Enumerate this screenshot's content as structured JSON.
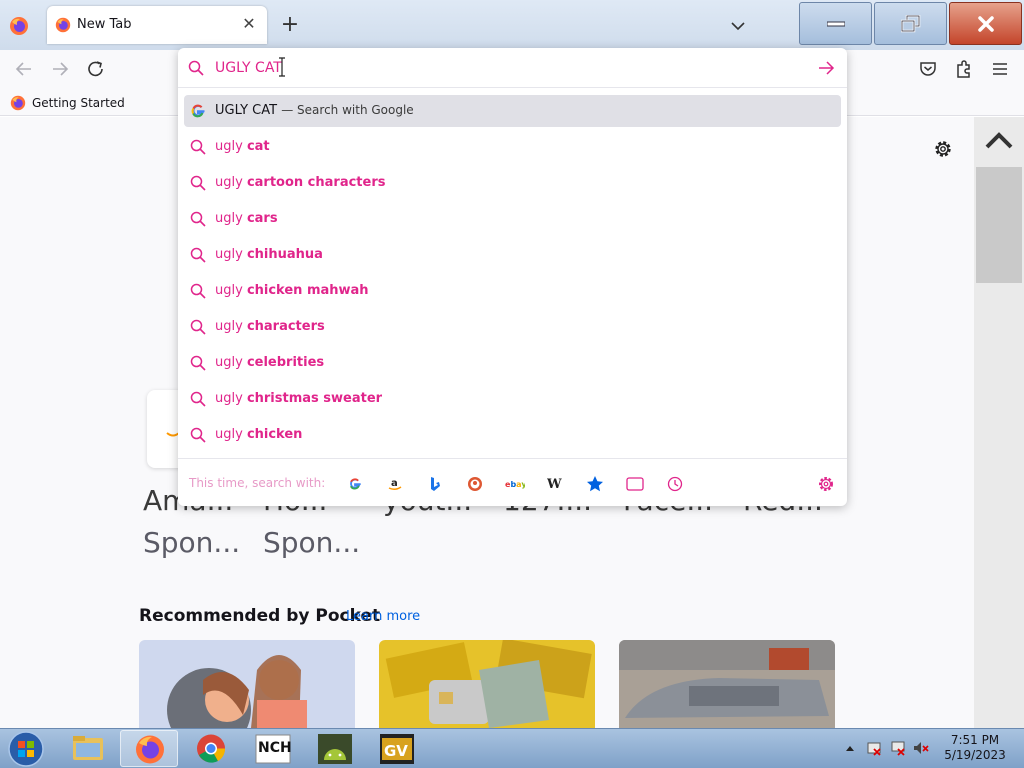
{
  "window": {
    "tab_title": "New Tab",
    "new_tab": "+",
    "close_tab": "✕"
  },
  "bookmarks": {
    "item_label": "Getting Started"
  },
  "urlbar": {
    "value": "UGLY CAT",
    "selected": {
      "text": "UGLY CAT",
      "engine": "— Search with Google"
    },
    "suggestions": [
      {
        "prefix": "ugly ",
        "bold": "cat"
      },
      {
        "prefix": "ugly ",
        "bold": "cartoon characters"
      },
      {
        "prefix": "ugly ",
        "bold": "cars"
      },
      {
        "prefix": "ugly ",
        "bold": "chihuahua"
      },
      {
        "prefix": "ugly ",
        "bold": "chicken mahwah"
      },
      {
        "prefix": "ugly ",
        "bold": "characters"
      },
      {
        "prefix": "ugly ",
        "bold": "celebrities"
      },
      {
        "prefix": "ugly ",
        "bold": "christmas sweater"
      },
      {
        "prefix": "ugly ",
        "bold": "chicken"
      }
    ],
    "oneoff_label": "This time, search with:",
    "engines": [
      "Google",
      "Amazon",
      "Bing",
      "DuckDuckGo",
      "eBay",
      "Wikipedia",
      "Bookmarks",
      "Tabs",
      "History"
    ]
  },
  "newtab": {
    "tiles": [
      {
        "title": "Ama...",
        "sub": "Spon..."
      },
      {
        "title": "Ho...",
        "sub": "Spon..."
      },
      {
        "title": "yout...",
        "sub": ""
      },
      {
        "title": "127....",
        "sub": ""
      },
      {
        "title": "Face...",
        "sub": ""
      },
      {
        "title": "Red...",
        "sub": ""
      }
    ],
    "pocket_heading": "Recommended by Pocket",
    "pocket_learn_more": "Learn more"
  },
  "taskbar": {
    "clock_time": "7:51 PM",
    "clock_date": "5/19/2023"
  },
  "colors": {
    "accent": "#e0258b",
    "link": "#0061e0",
    "taskbar": "#7fa1c8"
  }
}
